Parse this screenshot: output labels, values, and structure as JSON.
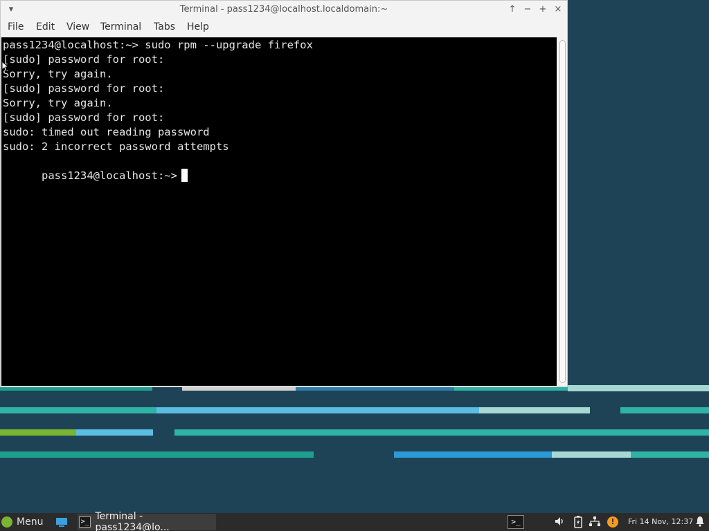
{
  "window": {
    "title": "Terminal - pass1234@localhost.localdomain:~",
    "controls": {
      "menu": "▾",
      "raise": "↑",
      "minimize": "−",
      "maximize": "+",
      "close": "×"
    }
  },
  "menubar": [
    "File",
    "Edit",
    "View",
    "Terminal",
    "Tabs",
    "Help"
  ],
  "terminal": {
    "lines": [
      "pass1234@localhost:~> sudo rpm --upgrade firefox",
      "[sudo] password for root:",
      "Sorry, try again.",
      "[sudo] password for root:",
      "Sorry, try again.",
      "[sudo] password for root:",
      "sudo: timed out reading password",
      "sudo: 2 incorrect password attempts"
    ],
    "prompt": "pass1234@localhost:~>"
  },
  "panel": {
    "menu_label": "Menu",
    "task_label": "Terminal - pass1234@lo...",
    "tray_terminal_glyph": ">_",
    "clock": "Fri 14 Nov, 12:37"
  },
  "colors": {
    "desktop": "#1e4356",
    "terminal_bg": "#000000",
    "panel": "#2b2b2b",
    "accent": "#7ab532"
  },
  "icons": [
    "mint-logo-icon",
    "show-desktop-icon",
    "terminal-icon",
    "volume-icon",
    "battery-icon",
    "network-icon",
    "update-shield-icon",
    "notification-bell-icon"
  ]
}
